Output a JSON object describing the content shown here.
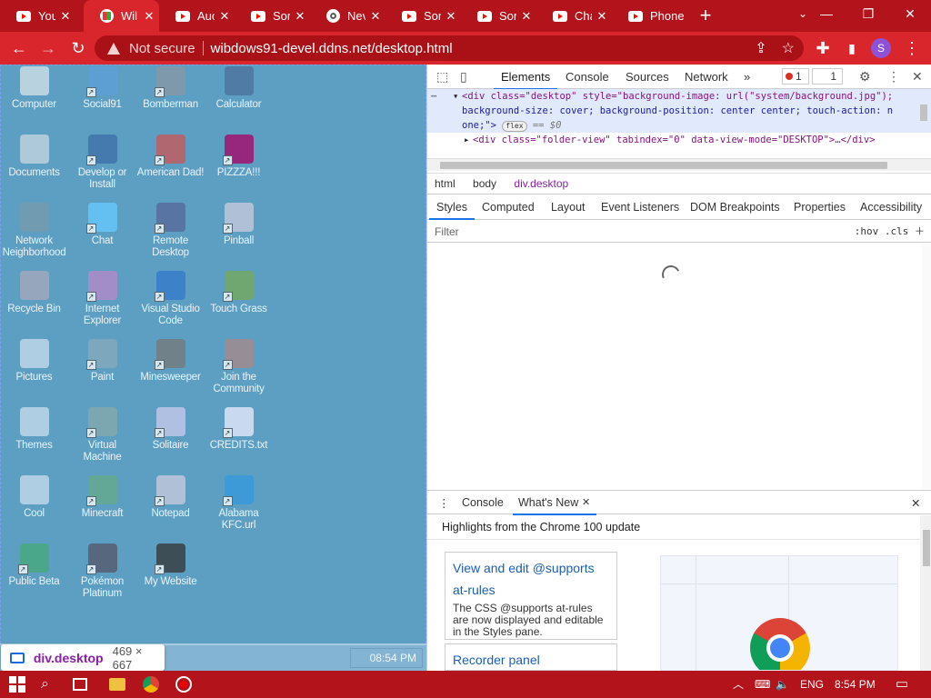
{
  "tabs": [
    {
      "label": "You",
      "favicon": "youtube-icon"
    },
    {
      "label": "Wil",
      "favicon": "windows-icon"
    },
    {
      "label": "Auc",
      "favicon": "youtube-icon"
    },
    {
      "label": "Sor",
      "favicon": "youtube-icon"
    },
    {
      "label": "Nev",
      "favicon": "chrome-icon"
    },
    {
      "label": "Sor",
      "favicon": "youtube-icon"
    },
    {
      "label": "Sor",
      "favicon": "youtube-icon"
    },
    {
      "label": "Cha",
      "favicon": "youtube-icon"
    },
    {
      "label": "Phone v",
      "favicon": "youtube-icon"
    }
  ],
  "window_controls": {
    "new_tab": "+",
    "chevron": "⌄",
    "minimize": "—",
    "maximize": "❐",
    "close": "✕"
  },
  "address": {
    "security": "Not secure",
    "url": "wibdows91-devel.ddns.net/desktop.html"
  },
  "profile_initial": "S",
  "desktop": {
    "icons": [
      {
        "label": "Computer"
      },
      {
        "label": "Social91"
      },
      {
        "label": "Bomberman"
      },
      {
        "label": "Calculator"
      },
      {
        "label": "Documents"
      },
      {
        "label": "Develop or Install"
      },
      {
        "label": "American Dad!"
      },
      {
        "label": "PIZZZA!!!"
      },
      {
        "label": "Network Neighborhood"
      },
      {
        "label": "Chat"
      },
      {
        "label": "Remote Desktop"
      },
      {
        "label": "Pinball"
      },
      {
        "label": "Recycle Bin"
      },
      {
        "label": "Internet Explorer"
      },
      {
        "label": "Visual Studio Code"
      },
      {
        "label": "Touch Grass"
      },
      {
        "label": "Pictures"
      },
      {
        "label": "Paint"
      },
      {
        "label": "Minesweeper"
      },
      {
        "label": "Join the Community"
      },
      {
        "label": "Themes"
      },
      {
        "label": "Virtual Machine"
      },
      {
        "label": "Solitaire"
      },
      {
        "label": "CREDITS.txt"
      },
      {
        "label": "Cool"
      },
      {
        "label": "Minecraft"
      },
      {
        "label": "Notepad"
      },
      {
        "label": "Alabama KFC.url"
      },
      {
        "label": "Public Beta"
      },
      {
        "label": "Pokémon Platinum"
      },
      {
        "label": "My Website"
      }
    ],
    "clock": "08:54 PM"
  },
  "inspect_tooltip": {
    "selector": "div.desktop",
    "dims": "469 × 667"
  },
  "devtools": {
    "tabs": [
      "Elements",
      "Console",
      "Sources",
      "Network"
    ],
    "more": "»",
    "errors": "1",
    "messages": "1",
    "code": {
      "line1_tag": "<div class=\"desktop\" style=\"background-image: url(\"system/background.jpg\");",
      "line2": "background-size: cover; background-position: center center; touch-action: n",
      "line3": "one;\">",
      "flex_badge": "flex",
      "eq": " == $0",
      "line4": "<div class=\"folder-view\" tabindex=\"0\" data-view-mode=\"DESKTOP\">…</div>"
    },
    "breadcrumbs": [
      "html",
      "body",
      "div.desktop"
    ],
    "sub_tabs": [
      "Styles",
      "Computed",
      "Layout",
      "Event Listeners",
      "DOM Breakpoints",
      "Properties",
      "Accessibility"
    ],
    "filter_placeholder": "Filter",
    "hov": ":hov",
    "cls": ".cls",
    "drawer": {
      "tabs": [
        "Console",
        "What's New"
      ],
      "heading": "Highlights from the Chrome 100 update",
      "cards": [
        {
          "title": "View and edit @supports at-rules",
          "desc": "The CSS @supports at-rules are now displayed and editable in the Styles pane."
        },
        {
          "title": "Recorder panel",
          "desc": ""
        }
      ]
    }
  },
  "taskbar": {
    "lang": "ENG",
    "time": "8:54 PM"
  }
}
